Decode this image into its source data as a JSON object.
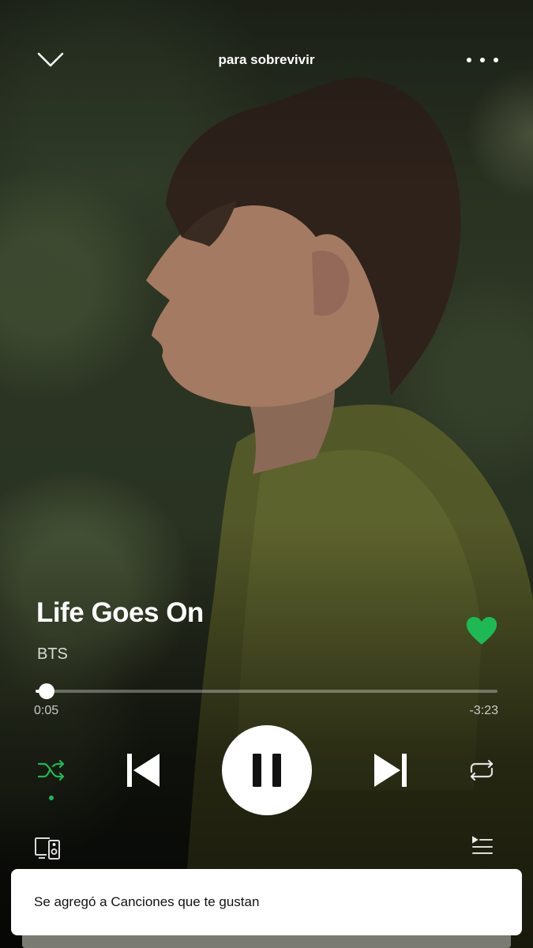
{
  "header": {
    "title": "para sobrevivir"
  },
  "track": {
    "title": "Life Goes On",
    "artist": "BTS",
    "liked": true
  },
  "progress": {
    "elapsed": "0:05",
    "remaining": "-3:23",
    "fraction": 0.024
  },
  "controls": {
    "shuffle_active": true,
    "state": "playing"
  },
  "toast": {
    "message": "Se agregó a Canciones que te gustan"
  },
  "colors": {
    "accent": "#1db954",
    "heart": "#1db954"
  },
  "icons": {
    "back": "chevron-down-icon",
    "more": "more-dots-icon",
    "heart": "heart-icon",
    "shuffle": "shuffle-icon",
    "previous": "skip-previous-icon",
    "pause": "pause-icon",
    "next": "skip-next-icon",
    "repeat": "repeat-icon",
    "devices": "devices-icon",
    "queue": "queue-icon"
  }
}
